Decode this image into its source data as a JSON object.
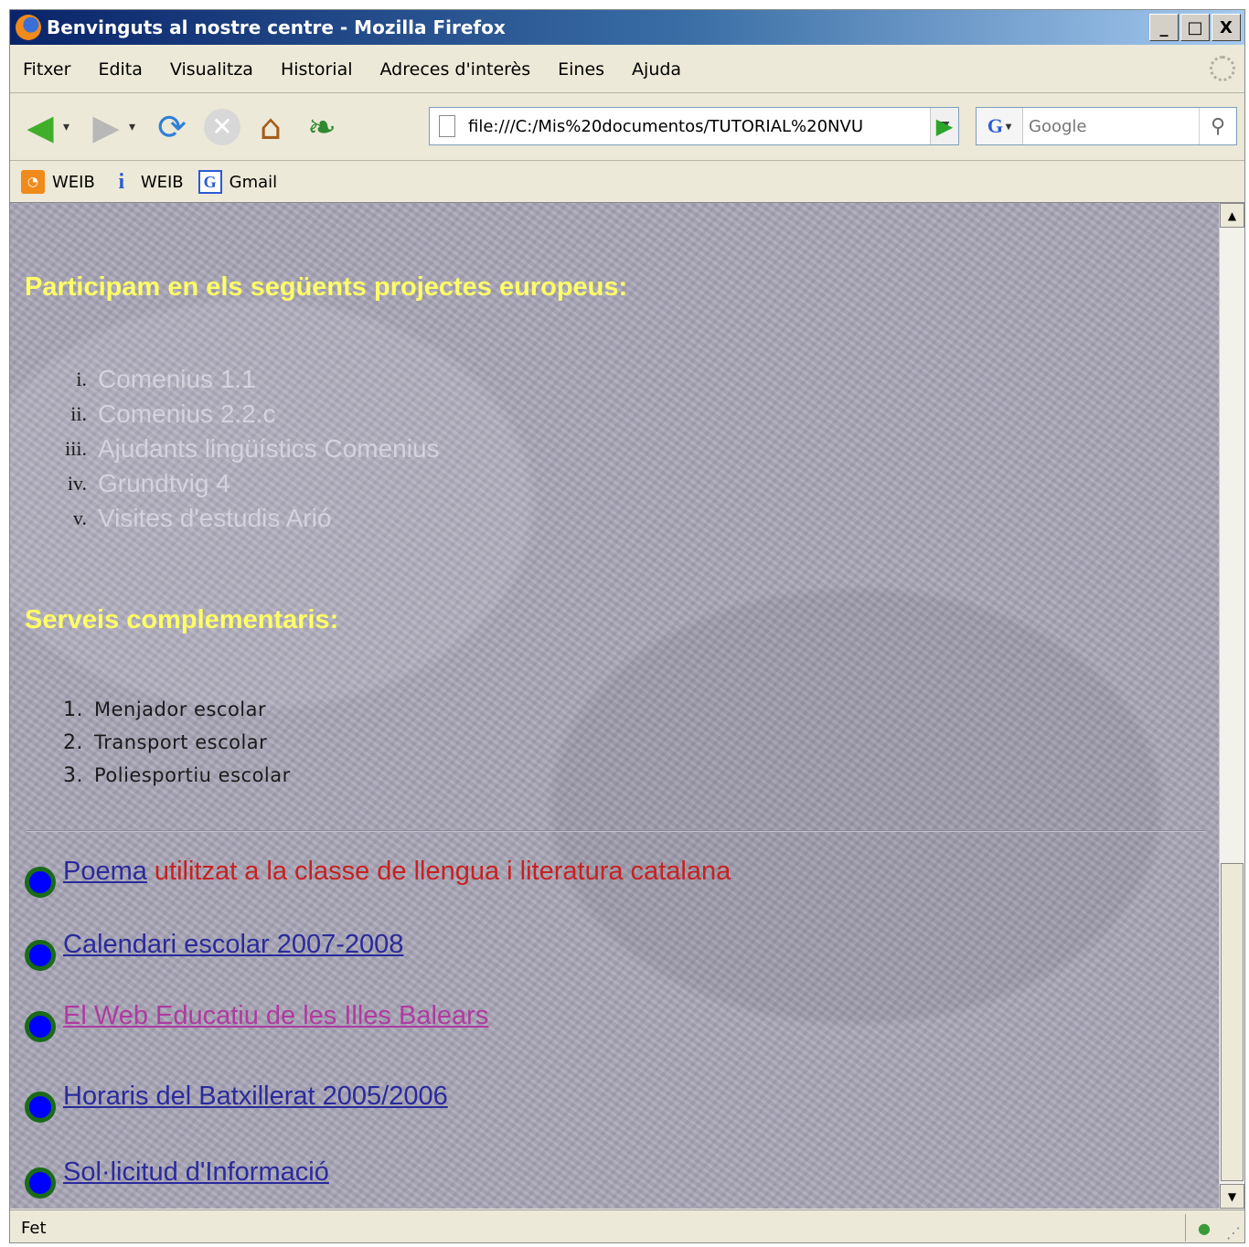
{
  "window": {
    "title": "Benvinguts al nostre centre - Mozilla Firefox",
    "minimize": "_",
    "maximize": "□",
    "close": "X"
  },
  "menu": [
    "Fitxer",
    "Edita",
    "Visualitza",
    "Historial",
    "Adreces d'interès",
    "Eines",
    "Ajuda"
  ],
  "toolbar": {
    "url": "file:///C:/Mis%20documentos/TUTORIAL%20NVU",
    "search_engine": "G",
    "search_placeholder": "Google",
    "icons": [
      "back-arrow-icon",
      "forward-arrow-icon",
      "reload-icon",
      "stop-icon",
      "home-icon",
      "leaf-icon",
      "go-icon",
      "magnifier-icon"
    ]
  },
  "bookmarks": [
    {
      "label": "WEIB",
      "icon": "rss-icon"
    },
    {
      "label": "WEIB",
      "icon": "info-icon"
    },
    {
      "label": "Gmail",
      "icon": "google-icon"
    }
  ],
  "content": {
    "projects_heading": "Participam en els següents projectes europeus:",
    "projects": [
      {
        "marker": "i.",
        "label": "Comenius 1.1"
      },
      {
        "marker": "ii.",
        "label": "Comenius 2.2.c"
      },
      {
        "marker": "iii.",
        "label": "Ajudants lingüístics Comenius"
      },
      {
        "marker": "iv.",
        "label": "Grundtvig 4"
      },
      {
        "marker": "v.",
        "label": "Visites d'estudis Arió"
      }
    ],
    "services_heading": "Serveis complementaris:",
    "services": [
      {
        "marker": "1.",
        "label": "Menjador escolar"
      },
      {
        "marker": "2.",
        "label": "Transport escolar"
      },
      {
        "marker": "3.",
        "label": "Poliesportiu escolar"
      }
    ],
    "links": [
      {
        "label": "Poema",
        "note": "utilitzat a la classe de llengua i literatura catalana"
      },
      {
        "label": "Calendari escolar 2007-2008"
      },
      {
        "label": "El Web Educatiu de les Illes Balears"
      },
      {
        "label": "Horaris del Batxillerat 2005/2006"
      },
      {
        "label": "Sol·licitud d'Informació"
      }
    ]
  },
  "status": {
    "text": "Fet"
  },
  "colors": {
    "heading": "#ffff66",
    "link": "#2a2a9c",
    "visited_link": "#b03aa0",
    "note": "#c82020",
    "background": "#a9a6b7"
  }
}
